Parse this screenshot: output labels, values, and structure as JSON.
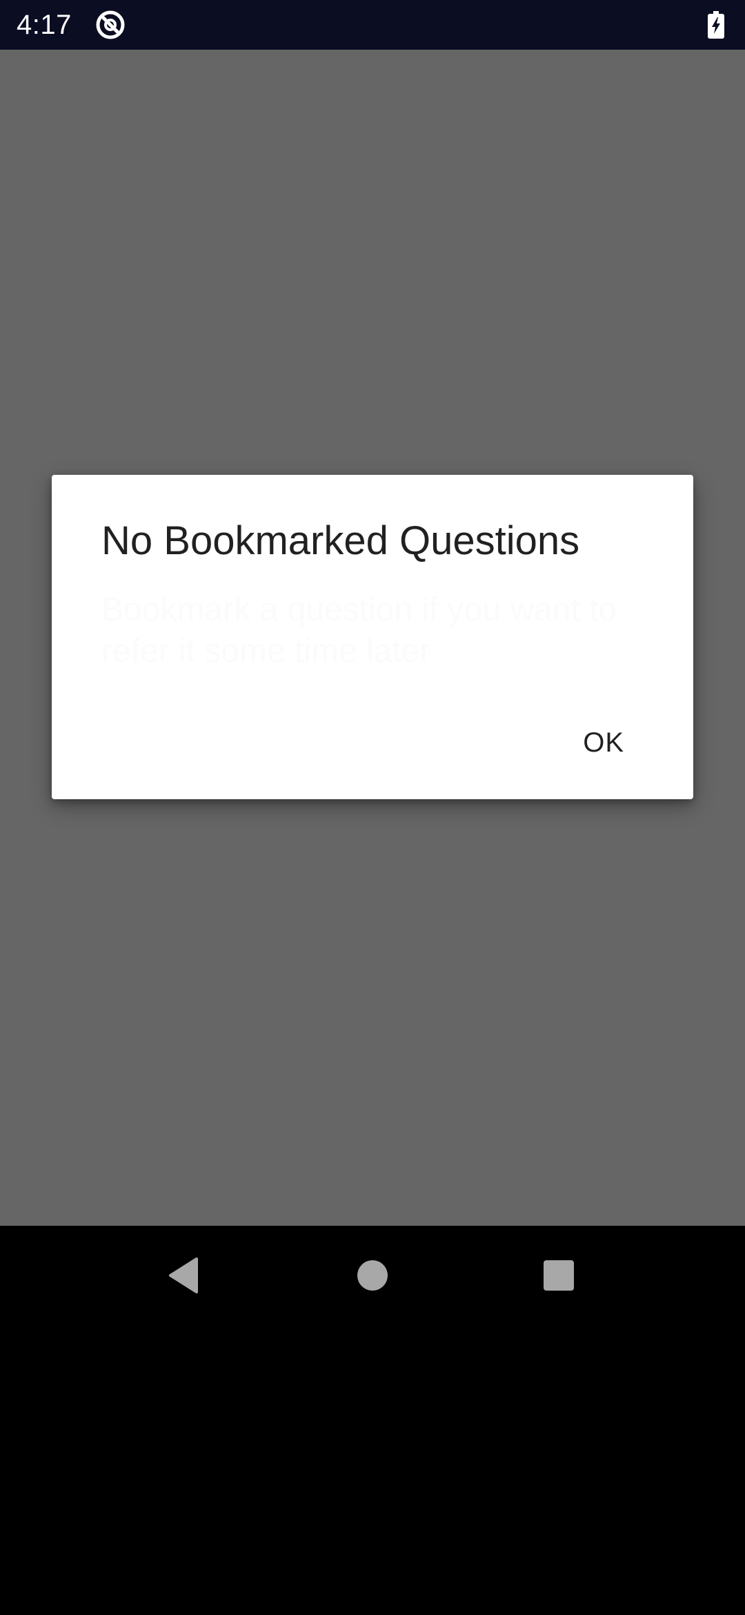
{
  "status_bar": {
    "time": "4:17",
    "app_icon": "data-sync-icon",
    "battery_icon": "battery-charging-icon"
  },
  "dialog": {
    "title": "No Bookmarked Questions",
    "message": "Bookmark a question if you want to refer it some time later",
    "ok_label": "OK"
  },
  "nav_bar": {
    "back_icon": "back-triangle-icon",
    "home_icon": "home-circle-icon",
    "recents_icon": "recents-square-icon"
  },
  "colors": {
    "status_bar_bg": "#0b0d22",
    "scrim": "#666666",
    "dialog_bg": "#ffffff",
    "title_text": "#212121",
    "nav_icon": "#a8a8a8"
  }
}
